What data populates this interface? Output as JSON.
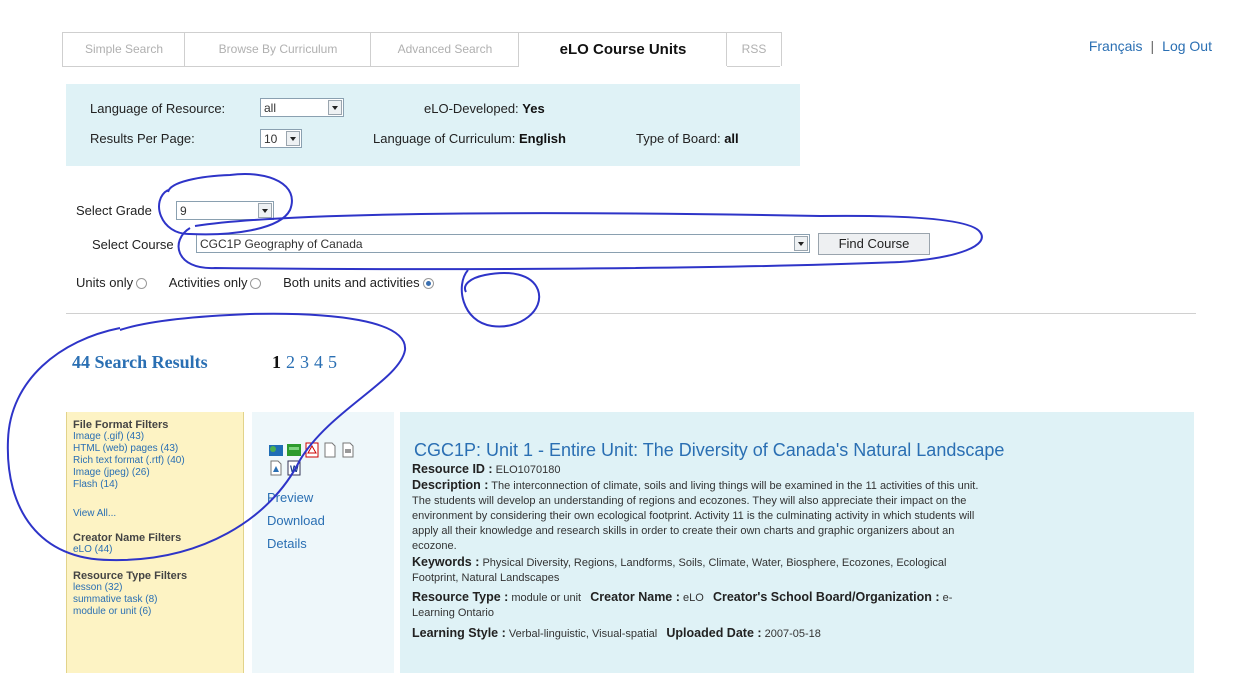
{
  "tabs": [
    {
      "label": "Simple Search",
      "active": false
    },
    {
      "label": "Browse By Curriculum",
      "active": false
    },
    {
      "label": "Advanced Search",
      "active": false
    },
    {
      "label": "eLO Course Units",
      "active": true
    },
    {
      "label": "RSS",
      "active": false
    }
  ],
  "top_links": {
    "francais": "Français",
    "separator": "|",
    "logout": "Log Out"
  },
  "settings": {
    "language_of_resource_label": "Language of Resource:",
    "language_of_resource_value": "all",
    "results_per_page_label": "Results Per Page:",
    "results_per_page_value": "10",
    "elo_developed_label": "eLO-Developed:",
    "elo_developed_value": "Yes",
    "language_of_curriculum_label": "Language of Curriculum:",
    "language_of_curriculum_value": "English",
    "type_of_board_label": "Type of Board:",
    "type_of_board_value": "all"
  },
  "search": {
    "select_grade_label": "Select Grade",
    "grade_value": "9",
    "select_course_label": "Select Course",
    "course_value": "CGC1P Geography of Canada",
    "find_course_button": "Find Course",
    "radio_units_only": "Units only",
    "radio_activities_only": "Activities only",
    "radio_both": "Both units and activities",
    "selected_radio": "both"
  },
  "results": {
    "count_label": "44 Search Results",
    "pages": [
      "1",
      "2",
      "3",
      "4",
      "5"
    ],
    "current_page": "1"
  },
  "filters": {
    "file_format_heading": "File Format Filters",
    "file_format_items": [
      "Image (.gif) (43)",
      "HTML (web) pages (43)",
      "Rich text format (.rtf) (40)",
      "Image (jpeg) (26)",
      "Flash (14)"
    ],
    "view_all": "View All...",
    "creator_heading": "Creator Name Filters",
    "creator_items": [
      "eLO (44)"
    ],
    "resource_type_heading": "Resource Type Filters",
    "resource_type_items": [
      "lesson (32)",
      "summative task (8)",
      "module or unit (6)"
    ]
  },
  "result_item": {
    "action_links": [
      "Preview",
      "Download",
      "Details"
    ],
    "icons": [
      "html-page-icon",
      "flash-icon",
      "pdf-icon",
      "blank-document-icon",
      "rtf-document-icon",
      "image-document-icon",
      "word-document-icon"
    ],
    "title": "CGC1P: Unit 1 - Entire Unit: The Diversity of Canada's Natural Landscape",
    "resource_id_label": "Resource ID :",
    "resource_id": "ELO1070180",
    "description_label": "Description :",
    "description_lines": [
      "The interconnection of climate, soils and living things will be examined in the 11 activities of this unit.",
      "The students will develop an understanding of regions and ecozones. They will also appreciate their impact on the",
      "environment by considering their own ecological footprint. Activity 11 is the culminating activity in which students will",
      "apply all their knowledge and research skills in order to create their own charts and graphic organizers about an",
      "ecozone."
    ],
    "keywords_label": "Keywords :",
    "keywords_lines": [
      "Physical Diversity, Regions, Landforms, Soils, Climate, Water, Biosphere, Ecozones, Ecological",
      "Footprint, Natural Landscapes"
    ],
    "resource_type_label": "Resource Type :",
    "resource_type": "module or unit",
    "creator_name_label": "Creator Name :",
    "creator_name": "eLO",
    "creator_board_label": "Creator's School Board/Organization :",
    "creator_board": "e-",
    "creator_board_cont": "Learning Ontario",
    "learning_style_label": "Learning Style :",
    "learning_style": "Verbal-linguistic, Visual-spatial",
    "uploaded_date_label": "Uploaded Date :",
    "uploaded_date": "2007-05-18"
  },
  "colors": {
    "accent": "#2a6fb3",
    "settings_bg": "#dff2f6",
    "filter_bg": "#fdf3c4",
    "annotation": "#2e34c8"
  }
}
